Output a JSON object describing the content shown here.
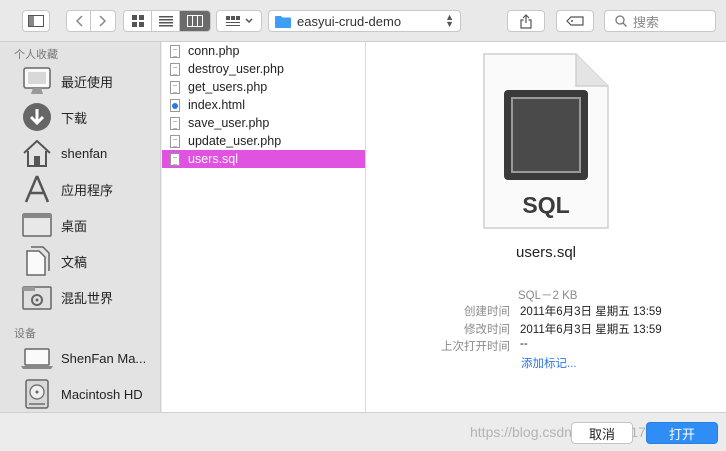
{
  "toolbar": {
    "path_label": "easyui-crud-demo",
    "search_placeholder": "搜索"
  },
  "sidebar": {
    "favorites_header": "个人收藏",
    "favorites": [
      {
        "label": "最近使用",
        "icon": "recents-icon"
      },
      {
        "label": "下载",
        "icon": "download-icon"
      },
      {
        "label": "shenfan",
        "icon": "home-icon"
      },
      {
        "label": "应用程序",
        "icon": "applications-icon"
      },
      {
        "label": "桌面",
        "icon": "desktop-icon"
      },
      {
        "label": "文稿",
        "icon": "documents-icon"
      },
      {
        "label": "混乱世界",
        "icon": "folder-icon"
      }
    ],
    "devices_header": "设备",
    "devices": [
      {
        "label": "ShenFan Ma...",
        "icon": "laptop-icon"
      },
      {
        "label": "Macintosh HD",
        "icon": "hard-disk-icon"
      }
    ]
  },
  "files": [
    {
      "name": "conn.php",
      "type": "php"
    },
    {
      "name": "destroy_user.php",
      "type": "php"
    },
    {
      "name": "get_users.php",
      "type": "php"
    },
    {
      "name": "index.html",
      "type": "html"
    },
    {
      "name": "save_user.php",
      "type": "php"
    },
    {
      "name": "update_user.php",
      "type": "php"
    },
    {
      "name": "users.sql",
      "type": "sql",
      "selected": true
    }
  ],
  "preview": {
    "icon_text": "SQL",
    "filename": "users.sql",
    "kind": "SQL－2 KB",
    "created_label": "创建时间",
    "created_value": "2011年6月3日 星期五 13:59",
    "modified_label": "修改时间",
    "modified_value": "2011年6月3日 星期五 13:59",
    "opened_label": "上次打开时间",
    "opened_value": "--",
    "add_tags": "添加标记..."
  },
  "buttons": {
    "cancel": "取消",
    "open": "打开"
  },
  "watermark": "https://blog.csdn.net/qq_41753984",
  "colors": {
    "selection": "#e052e0",
    "primary_button": "#2f8ef5",
    "link": "#2b78e4"
  }
}
